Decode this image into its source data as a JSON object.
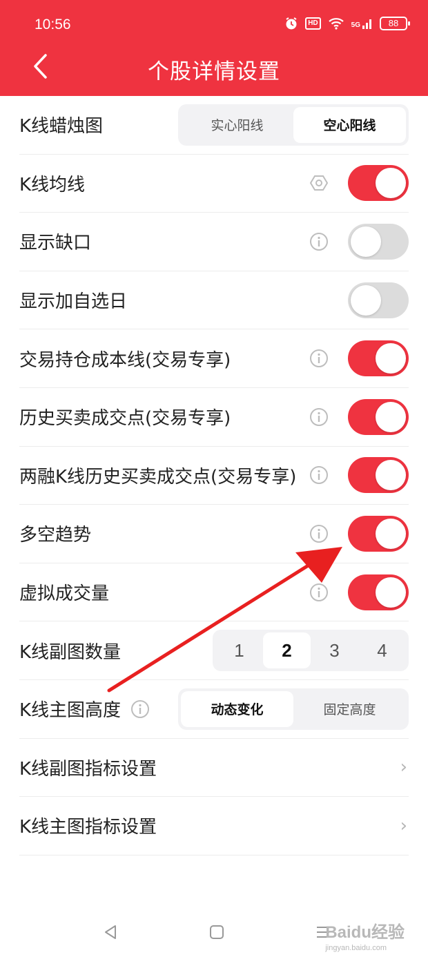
{
  "status_bar": {
    "time": "10:56",
    "battery": "88",
    "hd_label": "HD",
    "network_label": "5G"
  },
  "header": {
    "title": "个股详情设置",
    "accent_color": "#ef3340"
  },
  "candlestick": {
    "label": "K线蜡烛图",
    "options": [
      "实心阳线",
      "空心阳线"
    ],
    "selected": "空心阳线"
  },
  "toggles": [
    {
      "label": "K线均线",
      "icon": "settings-hex-icon",
      "on": true
    },
    {
      "label": "显示缺口",
      "icon": "info-icon",
      "on": false
    },
    {
      "label": "显示加自选日",
      "icon": null,
      "on": false
    },
    {
      "label": "交易持仓成本线(交易专享)",
      "icon": "info-icon",
      "on": true
    },
    {
      "label": "历史买卖成交点(交易专享)",
      "icon": "info-icon",
      "on": true
    },
    {
      "label": "两融K线历史买卖成交点(交易专享)",
      "icon": "info-icon",
      "on": true
    },
    {
      "label": "多空趋势",
      "icon": "info-icon",
      "on": true
    },
    {
      "label": "虚拟成交量",
      "icon": "info-icon",
      "on": true
    }
  ],
  "sub_chart_count": {
    "label": "K线副图数量",
    "options": [
      "1",
      "2",
      "3",
      "4"
    ],
    "selected": "2"
  },
  "main_chart_height": {
    "label": "K线主图高度",
    "options": [
      "动态变化",
      "固定高度"
    ],
    "selected": "动态变化"
  },
  "links": [
    {
      "label": "K线副图指标设置",
      "chevron": "›"
    },
    {
      "label": "K线主图指标设置",
      "chevron": "›"
    }
  ],
  "watermark": {
    "brand": "Baidu经验",
    "sub": "jingyan.baidu.com"
  }
}
